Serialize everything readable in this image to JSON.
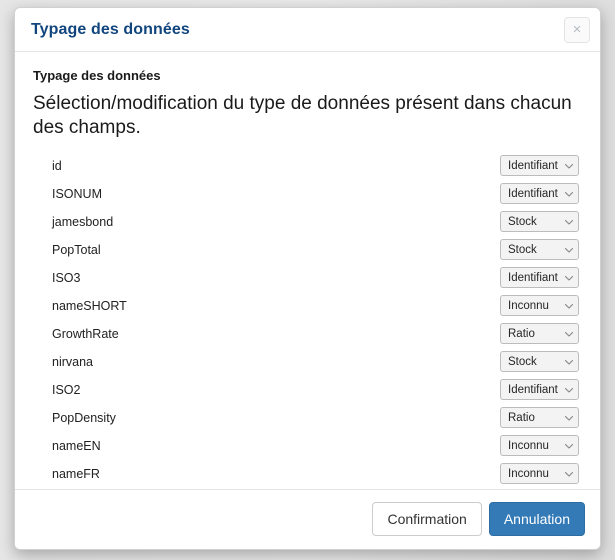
{
  "colors": {
    "title": "#11457e",
    "primary": "#337ab7",
    "primary_border": "#2e6da4",
    "modal_bg": "#ffffff",
    "backdrop": "#e6e6e6",
    "select_bg": "#f3f3f3",
    "select_border": "#bcbcbc",
    "divider": "#e5e5e5"
  },
  "modal": {
    "title": "Typage des données",
    "close_label": "×",
    "close_icon": "close-icon"
  },
  "body": {
    "heading": "Typage des données",
    "description": "Sélection/modification du type de données présent dans chacun des champs."
  },
  "type_options": [
    "Identifiant",
    "Stock",
    "Ratio",
    "Inconnu"
  ],
  "fields": [
    {
      "name": "id",
      "type": "Identifiant"
    },
    {
      "name": "ISONUM",
      "type": "Identifiant"
    },
    {
      "name": "jamesbond",
      "type": "Stock"
    },
    {
      "name": "PopTotal",
      "type": "Stock"
    },
    {
      "name": "ISO3",
      "type": "Identifiant"
    },
    {
      "name": "nameSHORT",
      "type": "Inconnu"
    },
    {
      "name": "GrowthRate",
      "type": "Ratio"
    },
    {
      "name": "nirvana",
      "type": "Stock"
    },
    {
      "name": "ISO2",
      "type": "Identifiant"
    },
    {
      "name": "PopDensity",
      "type": "Ratio"
    },
    {
      "name": "nameEN",
      "type": "Inconnu"
    },
    {
      "name": "nameFR",
      "type": "Inconnu"
    }
  ],
  "footer": {
    "confirm_label": "Confirmation",
    "cancel_label": "Annulation"
  }
}
